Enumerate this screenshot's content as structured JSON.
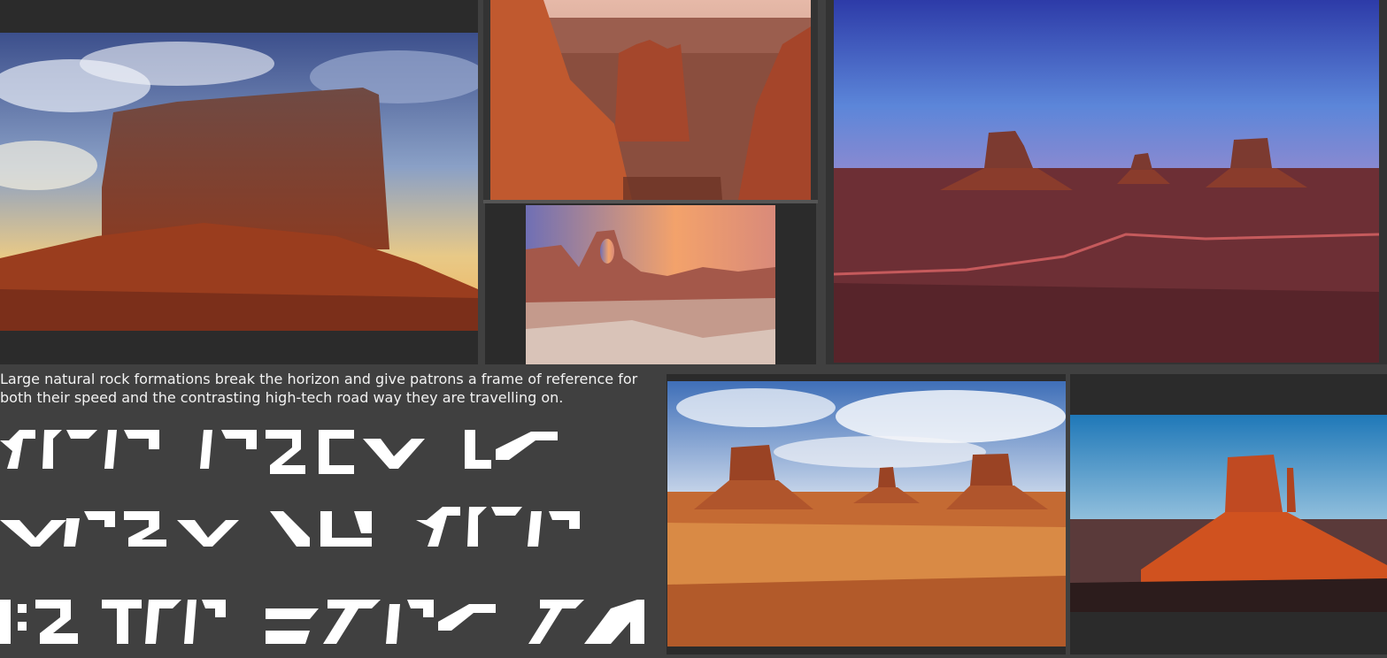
{
  "caption": "Large natural rock formations break the horizon and give patrons a frame of reference for both their speed and the contrasting high-tech road way they are travelling on.",
  "alien_text_lines": 3
}
